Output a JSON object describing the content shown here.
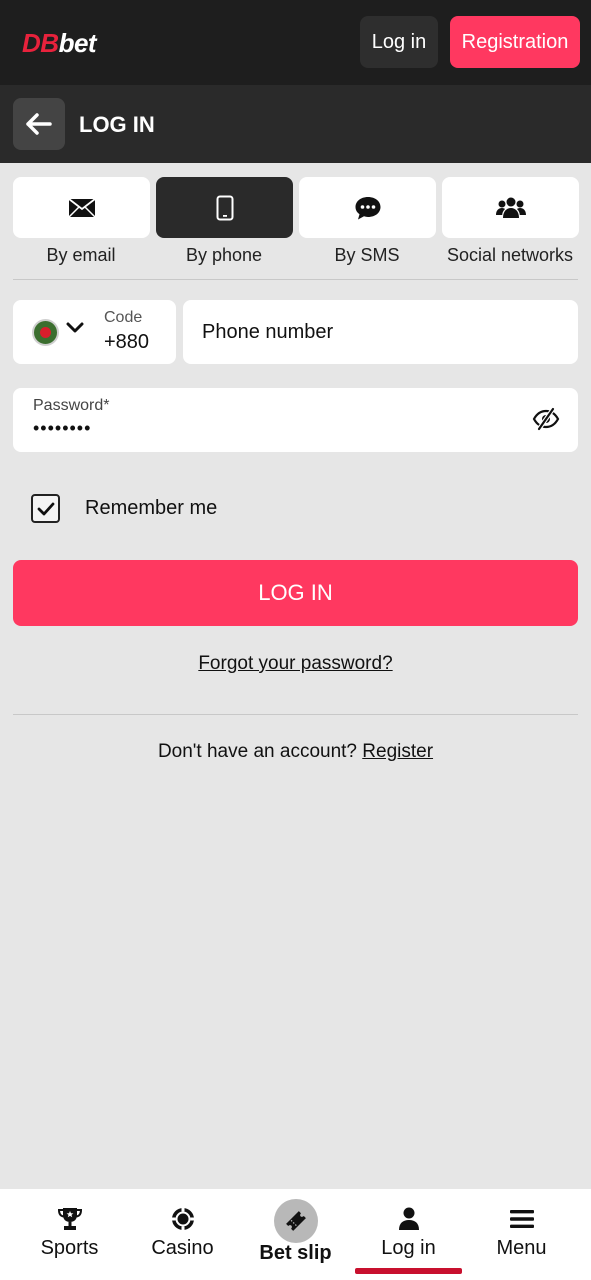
{
  "header": {
    "logo_prefix": "DB",
    "logo_suffix": "bet",
    "login_label": "Log in",
    "register_label": "Registration"
  },
  "subheader": {
    "title": "LOG IN",
    "back_icon": "arrow-left-icon"
  },
  "methods": [
    {
      "label": "By email",
      "icon": "envelope-icon",
      "active": false
    },
    {
      "label": "By phone",
      "icon": "mobile-phone-icon",
      "active": true
    },
    {
      "label": "By SMS",
      "icon": "chat-bubble-icon",
      "active": false
    },
    {
      "label": "Social networks",
      "icon": "users-icon",
      "active": false
    }
  ],
  "form": {
    "country_code_label": "Code",
    "country_code_value": "+880",
    "phone_placeholder": "Phone number",
    "password_label": "Password*",
    "password_value": "••••••••",
    "remember_label": "Remember me",
    "remember_checked": true,
    "submit_label": "LOG IN",
    "forgot_label": "Forgot your password?",
    "no_account_text": "Don't have an account?",
    "register_link": "Register"
  },
  "bottom_nav": {
    "items": [
      {
        "label": "Sports",
        "icon": "trophy-icon"
      },
      {
        "label": "Casino",
        "icon": "casino-chip-icon"
      },
      {
        "label": "Bet slip",
        "icon": "ticket-icon"
      },
      {
        "label": "Log in",
        "icon": "user-icon",
        "active": true
      },
      {
        "label": "Menu",
        "icon": "hamburger-menu-icon"
      }
    ]
  },
  "colors": {
    "brand_red": "#e8223c",
    "accent_pink": "#ff3860",
    "active_underline": "#c8102e",
    "dark_bg": "#1e1e1e"
  }
}
